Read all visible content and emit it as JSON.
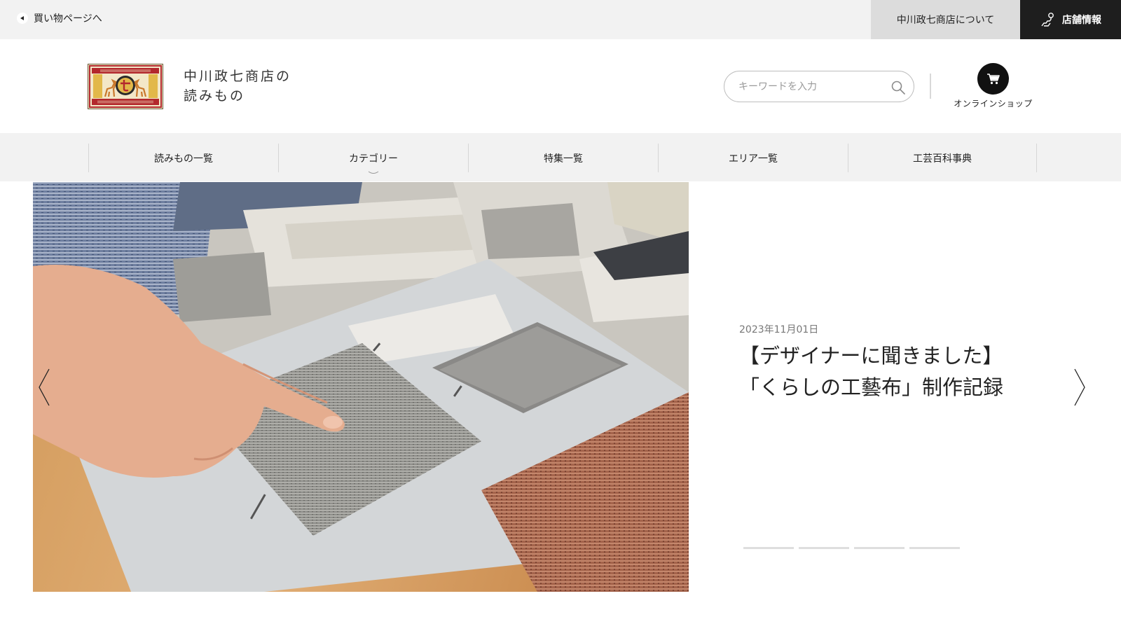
{
  "topbar": {
    "back_label": "買い物ページへ",
    "about_label": "中川政七商店について",
    "store_label": "店舗情報"
  },
  "header": {
    "logo_line1": "中川政七商店の",
    "logo_line2": "読みもの",
    "search_placeholder": "キーワードを入力",
    "shop_label": "オンラインショップ"
  },
  "nav": {
    "items": [
      "読みもの一覧",
      "カテゴリー",
      "特集一覧",
      "エリア一覧",
      "工芸百科事典"
    ]
  },
  "hero": {
    "date": "2023年11月01日",
    "title_line1": "【デザイナーに聞きました】",
    "title_line2": "「くらしの工藝布」制作記録",
    "slide_count": 4
  },
  "colors": {
    "topbar_bg": "#f2f2f2",
    "store_bg": "#1e1e1e",
    "about_bg": "#dcdcdc",
    "nav_bg": "#f2f2f2",
    "logo_red": "#b3282d",
    "logo_gold": "#e2b84a"
  },
  "icons": {
    "back": "back-arrow-icon",
    "store": "map-pin-icon",
    "search": "search-icon",
    "cart": "cart-icon",
    "prev": "chevron-left-icon",
    "next": "chevron-right-icon",
    "dropdown": "chevron-down-icon"
  }
}
